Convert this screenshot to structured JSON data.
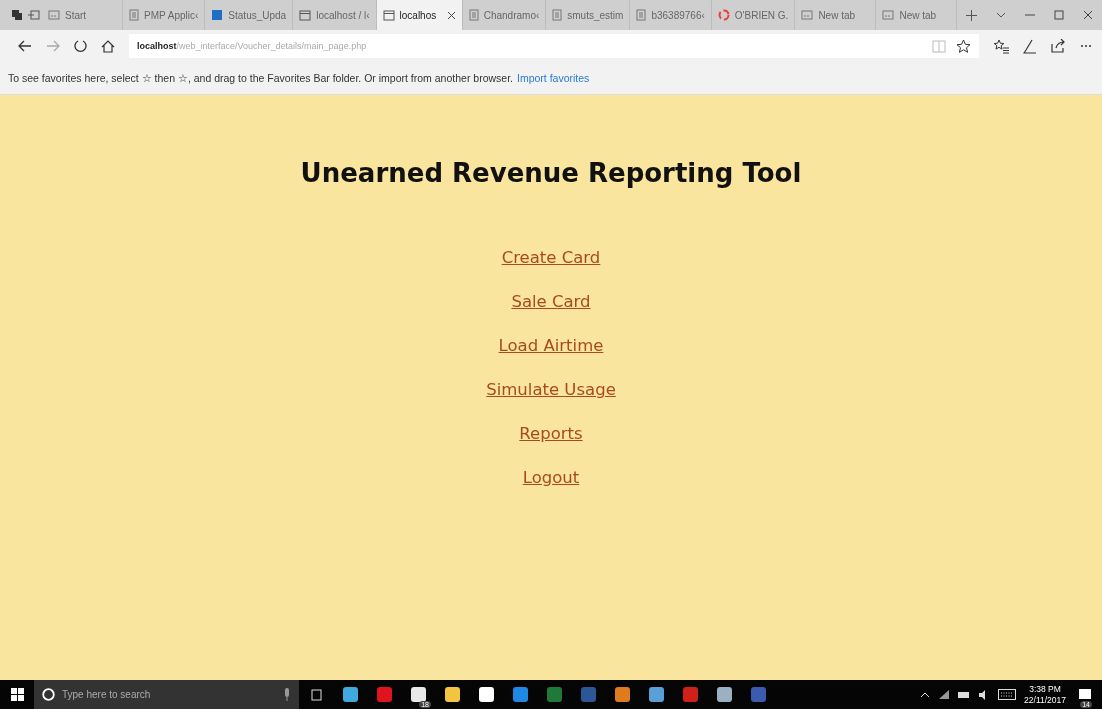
{
  "tabs": [
    {
      "title": "Start",
      "kind": "newtab",
      "selected": false
    },
    {
      "title": "PMP Applic‹",
      "kind": "doc",
      "selected": false
    },
    {
      "title": "Status_Upda",
      "kind": "outlook",
      "selected": false
    },
    {
      "title": "localhost / l‹",
      "kind": "window",
      "selected": false
    },
    {
      "title": "localhos",
      "kind": "window",
      "selected": true
    },
    {
      "title": "Chandramo‹",
      "kind": "doc",
      "selected": false
    },
    {
      "title": "smuts_estim",
      "kind": "doc",
      "selected": false
    },
    {
      "title": "b36389766‹",
      "kind": "doc",
      "selected": false
    },
    {
      "title": "O'BRIEN G.",
      "kind": "google",
      "selected": false
    },
    {
      "title": "New tab",
      "kind": "newtab",
      "selected": false
    },
    {
      "title": "New tab",
      "kind": "newtab",
      "selected": false
    }
  ],
  "address": {
    "host": "localhost",
    "path": "/web_interface/Voucher_details/main_page.php"
  },
  "favorites_bar": {
    "message": "To see favorites here, select ☆ then ☆, and drag to the Favorites Bar folder. Or import from another browser.",
    "link": "Import favorites"
  },
  "page": {
    "title": "Unearned Revenue Reporting Tool",
    "links": [
      "Create Card",
      "Sale Card",
      "Load Airtime",
      "Simulate Usage",
      "Reports",
      "Logout"
    ]
  },
  "taskbar": {
    "search_placeholder": "Type here to search",
    "apps": [
      {
        "color": "#3fa9e0"
      },
      {
        "color": "#e0141e"
      },
      {
        "color": "#e8e8e8",
        "badge": "18"
      },
      {
        "color": "#f3c440"
      },
      {
        "color": "#ffffff"
      },
      {
        "color": "#1e88e5"
      },
      {
        "color": "#1f7a3a"
      },
      {
        "color": "#2b5797"
      },
      {
        "color": "#e07a1f"
      },
      {
        "color": "#5aa0d8"
      },
      {
        "color": "#d0201a"
      },
      {
        "color": "#9bb0c0"
      },
      {
        "color": "#3b5bb0"
      }
    ],
    "time": "3:38 PM",
    "date": "22/11/2017",
    "notifications": "14"
  }
}
